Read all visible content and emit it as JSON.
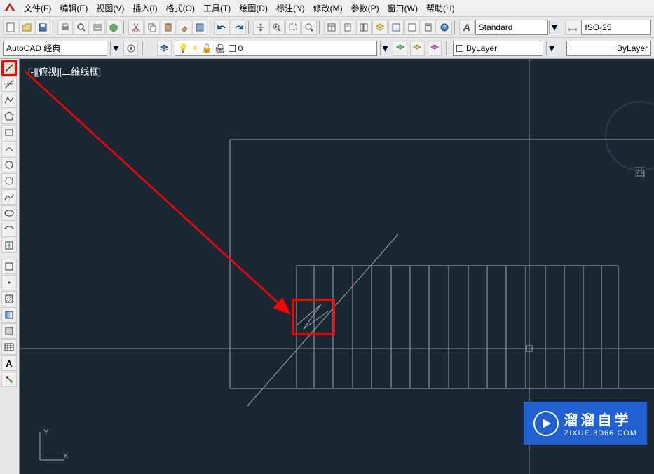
{
  "menu": {
    "file": "文件(F)",
    "edit": "编辑(E)",
    "view": "视图(V)",
    "insert": "插入(I)",
    "format": "格式(O)",
    "tools": "工具(T)",
    "draw": "绘图(D)",
    "dimension": "标注(N)",
    "modify": "修改(M)",
    "parametric": "参数(P)",
    "window": "窗口(W)",
    "help": "帮助(H)"
  },
  "toolbar": {
    "workspace": "AutoCAD 经典",
    "style": "Standard",
    "dim_style": "ISO-25",
    "layer": "0",
    "color": "ByLayer",
    "linetype": "ByLayer"
  },
  "canvas": {
    "view_label": "[-][俯视][二维线框]",
    "compass": "西"
  },
  "ucs": {
    "x": "X",
    "y": "Y"
  },
  "watermark": {
    "cn": "溜溜自学",
    "url": "ZIXUE.3D66.COM"
  },
  "icons": {
    "line": "line-icon",
    "cline": "construction-line-icon",
    "polyline": "polyline-icon",
    "polygon": "polygon-icon",
    "rectangle": "rectangle-icon",
    "arc": "arc-icon",
    "circle": "circle-icon",
    "spline": "spline-icon",
    "ellipse": "ellipse-icon",
    "ellipse_arc": "ellipse-arc-icon",
    "block": "insert-block-icon",
    "point": "point-icon",
    "hatch": "hatch-icon",
    "gradient": "gradient-icon",
    "region": "region-icon",
    "table": "table-icon",
    "text": "text-icon",
    "addsel": "add-selected-icon"
  }
}
